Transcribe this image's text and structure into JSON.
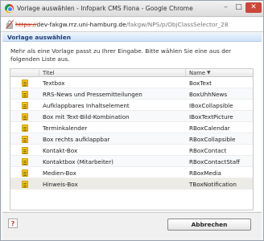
{
  "window": {
    "title": "Vorlage auswählen - Infopark CMS Fiona - Google Chrome",
    "url_scheme": "https://",
    "url_host": "dev-fakgw.rrz.uni-hamburg.de",
    "url_path": "/fakgw/NPS/p/ObjClassSelector_28"
  },
  "dialog": {
    "title": "Vorlage auswählen",
    "intro": "Mehr als eine Vorlage passt zu Ihrer Eingabe. Bitte wählen Sie eine aus der folgenden Liste aus."
  },
  "table": {
    "columns": {
      "title": "Titel",
      "name": "Name"
    },
    "sort_indicator": "▼",
    "rows": [
      {
        "title": "Textbox",
        "name": "BoxText"
      },
      {
        "title": "RRS-News und Pressemitteilungen",
        "name": "BoxUhhNews"
      },
      {
        "title": "Aufklappbares Inhaltselement",
        "name": "IBoxCollapsible"
      },
      {
        "title": "Box mit Text-Bild-Kombination",
        "name": "IBoxTextPicture"
      },
      {
        "title": "Terminkalender",
        "name": "RBoxCalendar"
      },
      {
        "title": "Box rechts aufklappbar",
        "name": "RBoxCollapsible"
      },
      {
        "title": "Kontakt-Box",
        "name": "RBoxContact"
      },
      {
        "title": "Kontaktbox (Mitarbeiter)",
        "name": "RBoxContactStaff"
      },
      {
        "title": "Medien-Box",
        "name": "RBoxMedia"
      },
      {
        "title": "Hinweis-Box",
        "name": "TBoxNotification"
      }
    ]
  },
  "footer": {
    "cancel_label": "Abbrechen",
    "help_glyph": "?"
  },
  "icons": {
    "app": "chrome-icon",
    "row": "document-template-icon",
    "help": "help-icon"
  },
  "colors": {
    "header_text": "#1e3f73",
    "close_button": "#c9483a",
    "row_icon": "#f3c623",
    "selected_row": "#ecebe6"
  }
}
